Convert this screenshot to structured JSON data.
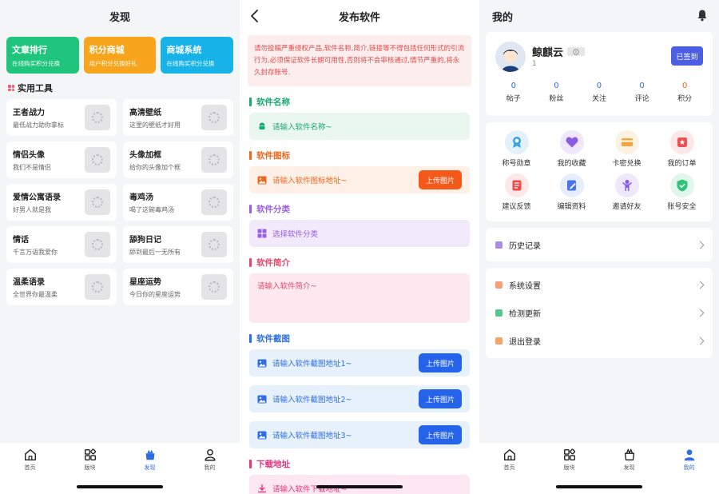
{
  "discover": {
    "title": "发现",
    "top_cards": [
      {
        "title": "文章排行",
        "subtitle": "在线购买积分兑换",
        "color": "#1fc47d"
      },
      {
        "title": "积分商城",
        "subtitle": "用户积分兑换好礼",
        "color": "#f7a51c"
      },
      {
        "title": "商城系统",
        "subtitle": "在线购买积分兑换",
        "color": "#17b3e8"
      }
    ],
    "section_title": "实用工具",
    "tools": [
      {
        "title": "王者战力",
        "subtitle": "最低战力助你拿标"
      },
      {
        "title": "高清壁纸",
        "subtitle": "这里的壁纸才好用"
      },
      {
        "title": "情侣头像",
        "subtitle": "我们不是情侣"
      },
      {
        "title": "头像加框",
        "subtitle": "给你的头像加个框"
      },
      {
        "title": "爱情公寓语录",
        "subtitle": "好男人就是我"
      },
      {
        "title": "毒鸡汤",
        "subtitle": "喝了这碗毒鸡汤"
      },
      {
        "title": "情话",
        "subtitle": "千言万语我爱你"
      },
      {
        "title": "舔狗日记",
        "subtitle": "舔到最后一无所有"
      },
      {
        "title": "温柔语录",
        "subtitle": "全世界你最温柔"
      },
      {
        "title": "星座运势",
        "subtitle": "今日你的星座运势"
      }
    ]
  },
  "tabbar": {
    "home": "首页",
    "blocks": "版块",
    "discover": "发现",
    "mine": "我的",
    "active_color": "#2e6de6"
  },
  "publish": {
    "title": "发布软件",
    "notice": "请勿投稿严重侵权产品,软件名称,简介,链接等不得包括任何形式的引流行为,必须保证软件长期可用性,否则将不会审核通过,情节严重的,将永久封存账号.",
    "name_label": "软件名称",
    "name_placeholder": "请输入软件名称~",
    "icon_label": "软件图标",
    "icon_placeholder": "请输入软件图标地址~",
    "upload_label": "上传图片",
    "category_label": "软件分类",
    "category_placeholder": "选择软件分类",
    "intro_label": "软件简介",
    "intro_placeholder": "请输入软件简介~",
    "screens_label": "软件截图",
    "screen1_placeholder": "请输入软件截图地址1~",
    "screen2_placeholder": "请输入软件截图地址2~",
    "screen3_placeholder": "请输入软件截图地址3~",
    "download_label": "下载地址",
    "download_placeholder": "请输入软件下载地址~"
  },
  "mine": {
    "title": "我的",
    "username": "鲸麒云",
    "user_id": "1",
    "sign_label": "已签到",
    "stats": [
      {
        "value": "0",
        "label": "帖子"
      },
      {
        "value": "0",
        "label": "粉丝"
      },
      {
        "value": "0",
        "label": "关注"
      },
      {
        "value": "0",
        "label": "评论"
      },
      {
        "value": "0",
        "label": "积分"
      }
    ],
    "actions": [
      {
        "label": "称号勋章",
        "icon": "medal-icon"
      },
      {
        "label": "我的收藏",
        "icon": "heart-icon"
      },
      {
        "label": "卡密兑换",
        "icon": "card-icon"
      },
      {
        "label": "我的订单",
        "icon": "order-icon"
      },
      {
        "label": "建议反馈",
        "icon": "feedback-icon"
      },
      {
        "label": "编辑资料",
        "icon": "edit-icon"
      },
      {
        "label": "邀请好友",
        "icon": "invite-icon"
      },
      {
        "label": "账号安全",
        "icon": "shield-icon"
      }
    ],
    "history": "历史记录",
    "settings": "系统设置",
    "update": "检测更新",
    "logout": "退出登录"
  }
}
